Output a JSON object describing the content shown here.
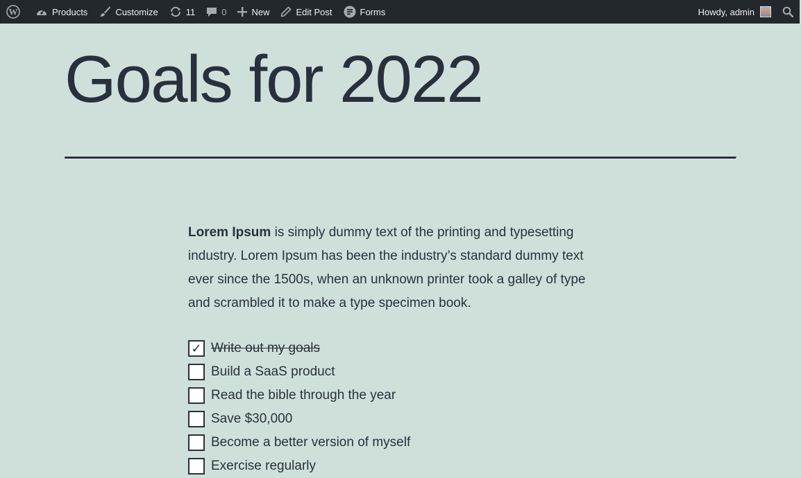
{
  "adminbar": {
    "wp_logo_icon": "wordpress-logo-icon",
    "products_label": "Products",
    "customize_label": "Customize",
    "updates_count": "11",
    "comments_count": "0",
    "new_label": "New",
    "edit_post_label": "Edit Post",
    "forms_label": "Forms",
    "howdy_label": "Howdy, admin"
  },
  "post": {
    "title": "Goals for 2022",
    "intro_bold": "Lorem Ipsum",
    "intro_rest": " is simply dummy text of the printing and typesetting industry. Lorem Ipsum has been the industry’s standard dummy text ever since the 1500s, when an unknown printer took a galley of type and scrambled it to make a type specimen book.",
    "checklist": [
      {
        "label": "Write out my goals",
        "checked": true,
        "mark": "✓"
      },
      {
        "label": "Build a SaaS product",
        "checked": false,
        "mark": ""
      },
      {
        "label": "Read the bible through the year",
        "checked": false,
        "mark": ""
      },
      {
        "label": "Save $30,000",
        "checked": false,
        "mark": ""
      },
      {
        "label": "Become a better version of myself",
        "checked": false,
        "mark": ""
      },
      {
        "label": "Exercise regularly",
        "checked": false,
        "mark": ""
      }
    ]
  },
  "colors": {
    "background": "#cfe0da",
    "adminbar": "#23282d",
    "text": "#28303d"
  }
}
